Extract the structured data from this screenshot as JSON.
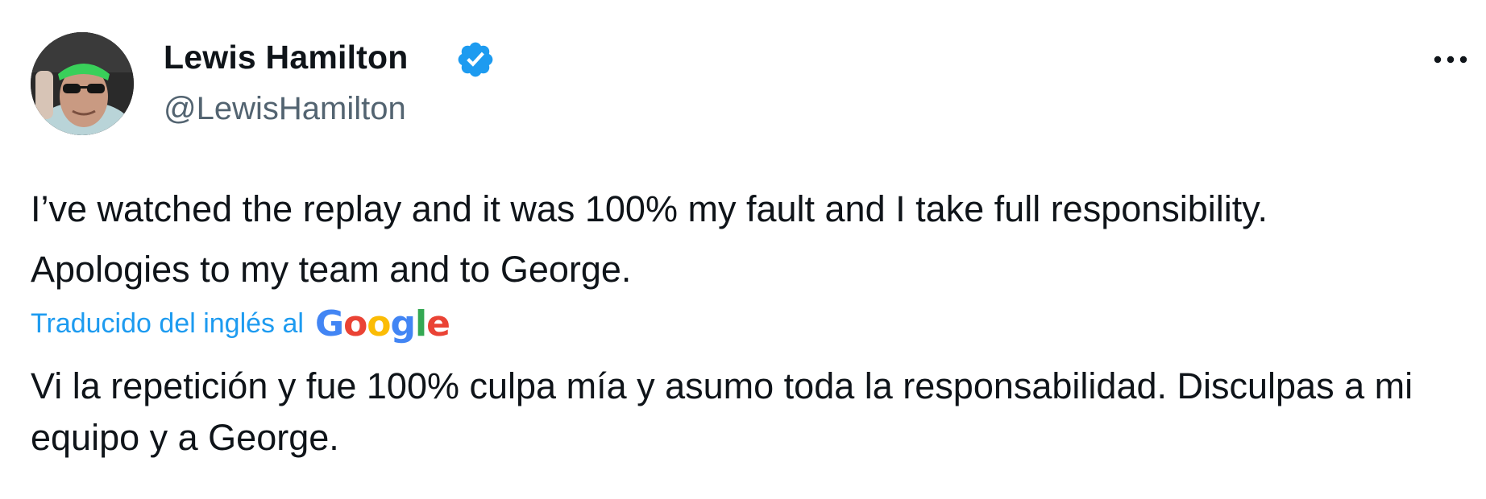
{
  "author": {
    "display_name": "Lewis Hamilton",
    "handle": "@LewisHamilton",
    "verified": true,
    "avatar_icon": "profile-photo-avatar"
  },
  "menu": {
    "more_icon": "more-options-icon"
  },
  "tweet": {
    "text": "I’ve watched the replay and it was 100% my fault and I take full responsibility. Apologies to my team and to George."
  },
  "translation": {
    "label": "Traducido del inglés al",
    "provider": "Google",
    "text": "Vi la repetición y fue 100% culpa mía y asumo toda la responsabilidad. Disculpas a mi equipo y a George."
  },
  "colors": {
    "link_blue": "#1d9bf0",
    "verified_blue": "#1d9bf0",
    "secondary_text": "#536471",
    "primary_text": "#0f1419"
  }
}
